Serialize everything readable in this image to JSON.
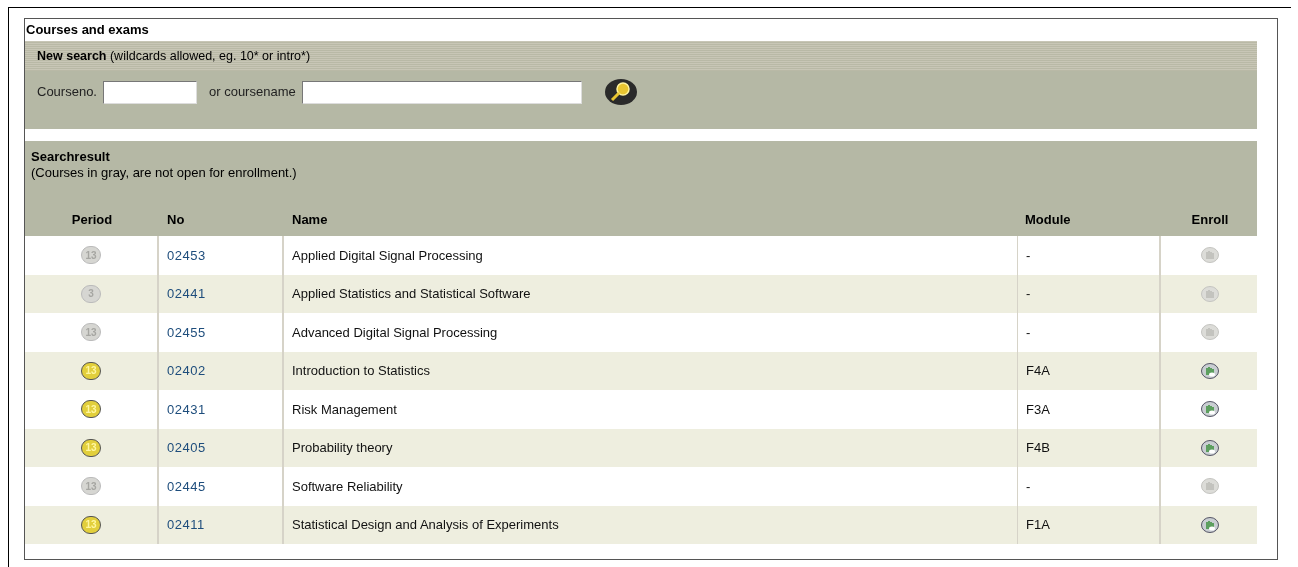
{
  "title": "Courses and exams",
  "search": {
    "heading": "New search",
    "hint": "(wildcards allowed, eg. 10* or intro*)",
    "courseno_label": "Courseno.",
    "coursename_label": "or coursename"
  },
  "result": {
    "heading": "Searchresult",
    "note": "(Courses in gray, are not open for enrollment.)",
    "columns": [
      "Period",
      "No",
      "Name",
      "Module",
      "Enroll"
    ],
    "rows": [
      {
        "period": "13",
        "no": "02453",
        "name": "Applied Digital Signal Processing",
        "module": "-",
        "open": false
      },
      {
        "period": "3",
        "no": "02441",
        "name": "Applied Statistics and Statistical Software",
        "module": "-",
        "open": false
      },
      {
        "period": "13",
        "no": "02455",
        "name": "Advanced Digital Signal Processing",
        "module": "-",
        "open": false
      },
      {
        "period": "13",
        "no": "02402",
        "name": "Introduction to Statistics",
        "module": "F4A",
        "open": true
      },
      {
        "period": "13",
        "no": "02431",
        "name": "Risk Management",
        "module": "F3A",
        "open": true
      },
      {
        "period": "13",
        "no": "02405",
        "name": "Probability theory",
        "module": "F4B",
        "open": true
      },
      {
        "period": "13",
        "no": "02445",
        "name": "Software Reliability",
        "module": "-",
        "open": false
      },
      {
        "period": "13",
        "no": "02411",
        "name": "Statistical Design and Analysis of Experiments",
        "module": "F1A",
        "open": true
      }
    ]
  }
}
